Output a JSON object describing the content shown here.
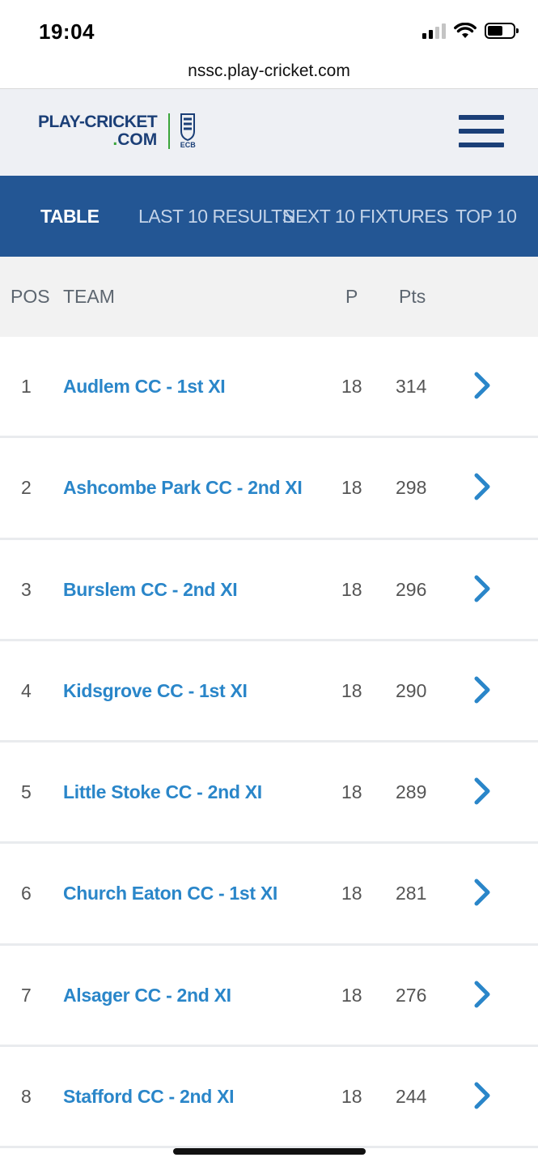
{
  "status_bar": {
    "time": "19:04"
  },
  "browser": {
    "url": "nssc.play-cricket.com"
  },
  "header": {
    "logo_line1": "PLAY-CRICKET",
    "logo_line2_dot": ".",
    "logo_line2": "COM",
    "badge_text": "ECB",
    "menu_icon": "hamburger-menu-icon"
  },
  "tabs": [
    {
      "label": "TABLE",
      "active": true
    },
    {
      "label": "LAST 10 RESULTS",
      "active": false
    },
    {
      "label": "NEXT 10 FIXTURES",
      "active": false
    },
    {
      "label": "TOP 10",
      "active": false
    }
  ],
  "table": {
    "columns": {
      "pos": "POS",
      "team": "TEAM",
      "played": "P",
      "points": "Pts"
    },
    "rows": [
      {
        "pos": "1",
        "team": "Audlem CC - 1st XI",
        "played": "18",
        "points": "314"
      },
      {
        "pos": "2",
        "team": "Ashcombe Park CC - 2nd XI",
        "played": "18",
        "points": "298"
      },
      {
        "pos": "3",
        "team": "Burslem CC - 2nd XI",
        "played": "18",
        "points": "296"
      },
      {
        "pos": "4",
        "team": "Kidsgrove CC - 1st XI",
        "played": "18",
        "points": "290"
      },
      {
        "pos": "5",
        "team": "Little Stoke CC - 2nd XI",
        "played": "18",
        "points": "289"
      },
      {
        "pos": "6",
        "team": "Church Eaton CC - 1st XI",
        "played": "18",
        "points": "281"
      },
      {
        "pos": "7",
        "team": "Alsager CC - 2nd XI",
        "played": "18",
        "points": "276"
      },
      {
        "pos": "8",
        "team": "Stafford CC - 2nd XI",
        "played": "18",
        "points": "244"
      }
    ]
  },
  "colors": {
    "brand_navy": "#1b3f77",
    "tab_bar": "#235694",
    "team_link": "#2a86c9",
    "logo_green": "#3aa53a"
  }
}
